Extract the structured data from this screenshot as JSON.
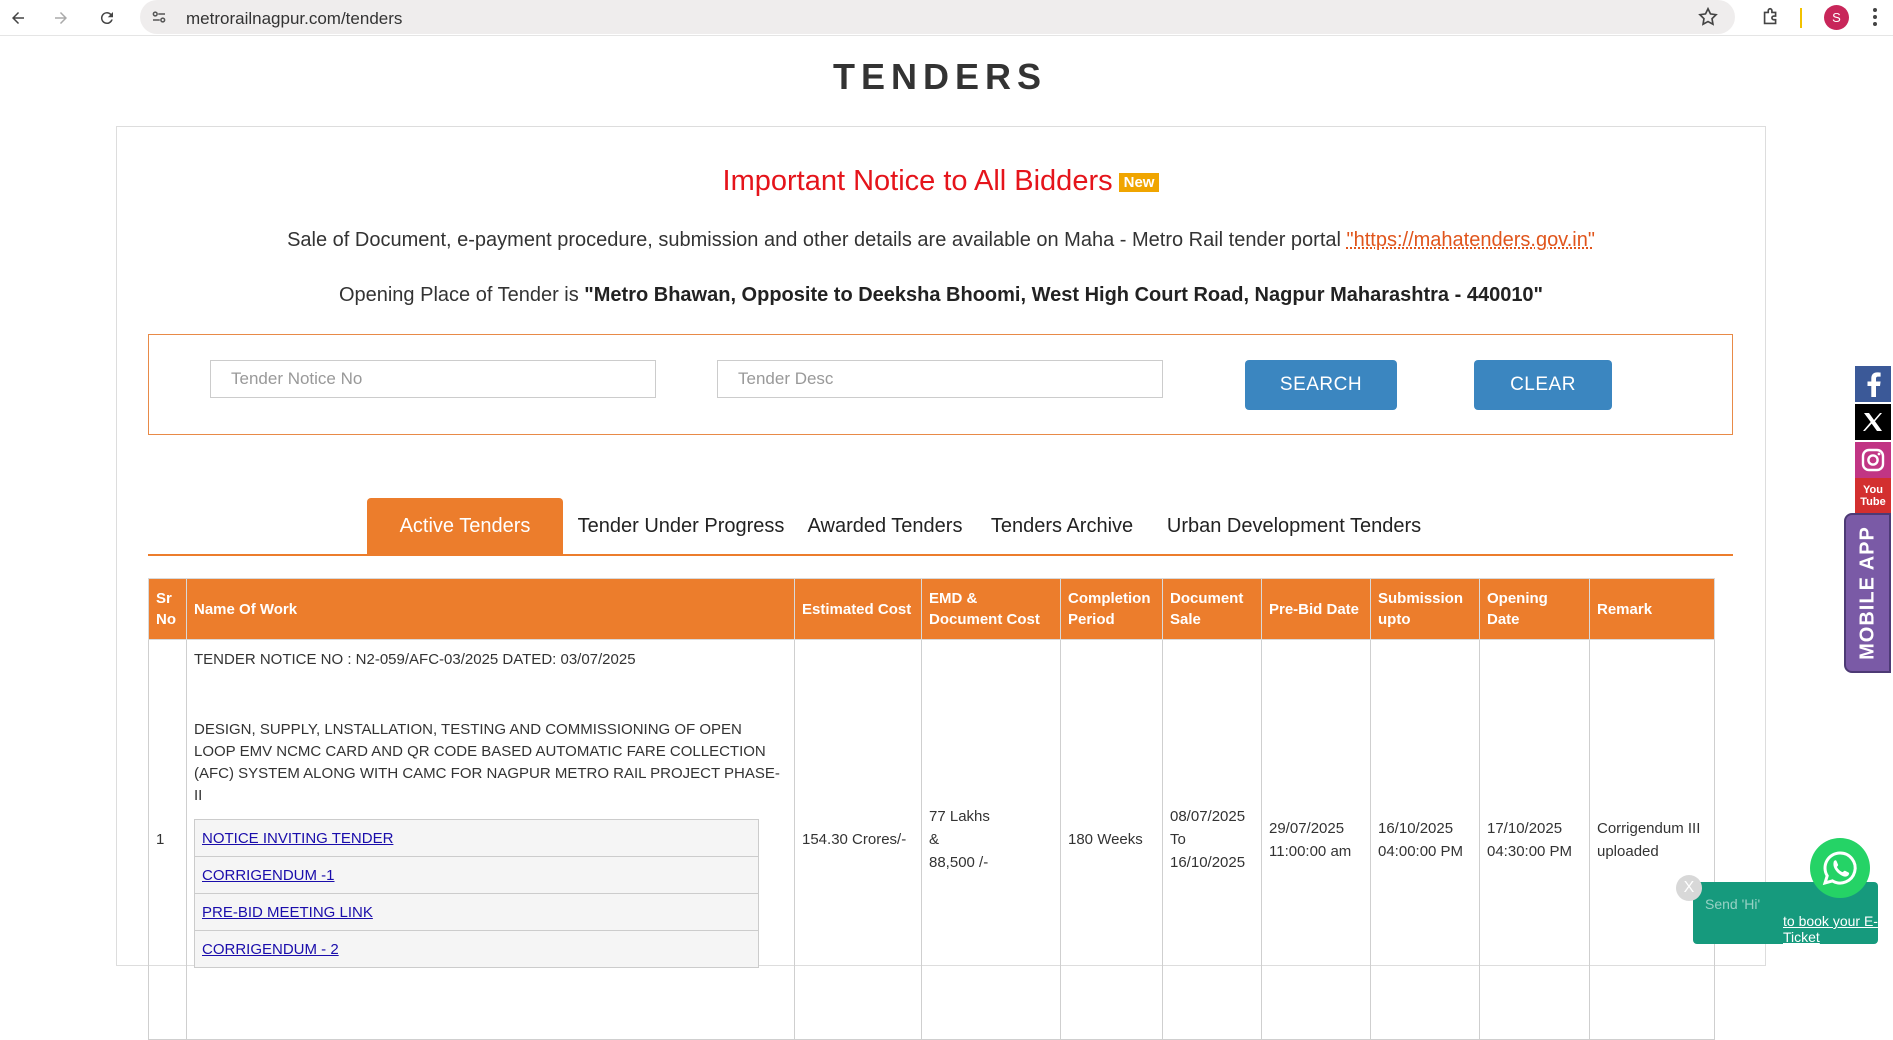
{
  "browser": {
    "url": "metrorailnagpur.com/tenders",
    "avatar_letter": "S"
  },
  "page": {
    "title": "TENDERS"
  },
  "notice": {
    "title": "Important Notice to All Bidders",
    "badge": "New",
    "line1_text": "Sale of Document, e-payment procedure, submission and other details are available on Maha - Metro Rail tender portal ",
    "line1_link": "\"https://mahatenders.gov.in\"",
    "line2_text": "Opening Place of Tender is ",
    "line2_bold": "\"Metro Bhawan, Opposite to Deeksha Bhoomi, West High Court Road, Nagpur Maharashtra - 440010\""
  },
  "search": {
    "notice_placeholder": "Tender Notice No",
    "desc_placeholder": "Tender Desc",
    "search_label": "SEARCH",
    "clear_label": "CLEAR"
  },
  "tabs": [
    {
      "label": "Active Tenders",
      "active": true
    },
    {
      "label": "Tender Under Progress",
      "active": false
    },
    {
      "label": "Awarded Tenders",
      "active": false
    },
    {
      "label": "Tenders Archive",
      "active": false
    },
    {
      "label": "Urban Development Tenders",
      "active": false
    }
  ],
  "table": {
    "headers": {
      "sr": "Sr No",
      "name": "Name Of Work",
      "cost": "Estimated Cost",
      "emd": "EMD & Document Cost",
      "completion": "Completion Period",
      "doc_sale": "Document Sale",
      "prebid": "Pre-Bid Date",
      "submission": "Submission upto",
      "opening": "Opening Date",
      "remark": "Remark"
    },
    "rows": [
      {
        "sr": "1",
        "notice_no": "TENDER NOTICE NO : N2-059/AFC-03/2025 DATED: 03/07/2025",
        "description": "DESIGN, SUPPLY, LNSTALLATION, TESTING AND COMMISSIONING OF OPEN LOOP EMV NCMC CARD AND QR CODE BASED AUTOMATIC FARE COLLECTION (AFC) SYSTEM ALONG WITH CAMC FOR NAGPUR METRO RAIL PROJECT PHASE-II",
        "documents": [
          "NOTICE INVITING TENDER",
          "CORRIGENDUM -1",
          "PRE-BID MEETING LINK",
          "CORRIGENDUM - 2"
        ],
        "cost": "154.30 Crores/-",
        "emd_1": "77 Lakhs",
        "emd_2": "&",
        "emd_3": "88,500 /-",
        "completion": "180 Weeks",
        "doc_sale_1": "08/07/2025",
        "doc_sale_2": "To",
        "doc_sale_3": "16/10/2025",
        "prebid_1": "29/07/2025",
        "prebid_2": "11:00:00 am",
        "submission_1": "16/10/2025",
        "submission_2": "04:00:00 PM",
        "opening_1": "17/10/2025",
        "opening_2": "04:30:00 PM",
        "remark": "Corrigendum III uploaded"
      }
    ]
  },
  "sidebar": {
    "mobile_app": "MOBILE APP",
    "youtube_1": "You",
    "youtube_2": "Tube"
  },
  "whatsapp": {
    "line1": "Send 'Hi'",
    "line2": "to book your E-Ticket",
    "close": "X"
  },
  "colors": {
    "accent_orange": "#ec7d2c",
    "notice_red": "#e5141b",
    "button_blue": "#3b86c0",
    "facebook": "#3b5998",
    "instagram": "#c13584",
    "youtube": "#d32f2f",
    "whatsapp": "#25d366"
  }
}
